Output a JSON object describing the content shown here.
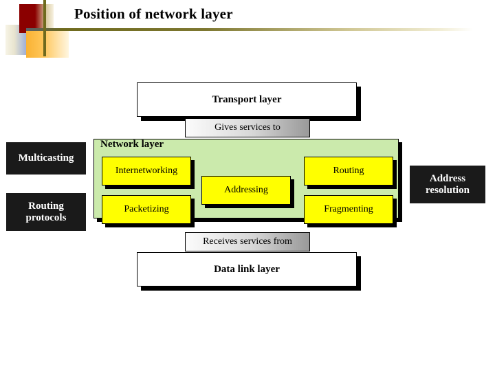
{
  "slide": {
    "title": "Position of network layer",
    "logo": {
      "red_color": "#8b0000",
      "blue_color": "#3b5bb5",
      "orange_color": "#f9b233",
      "rule_color": "#6f6a1e"
    }
  },
  "diagram": {
    "layers": {
      "transport": "Transport layer",
      "data_link": "Data link layer",
      "network": "Network layer"
    },
    "connectors": {
      "top": "Gives services to",
      "bottom": "Receives services from"
    },
    "functions": [
      {
        "label": "Internetworking"
      },
      {
        "label": "Packetizing"
      },
      {
        "label": "Addressing"
      },
      {
        "label": "Routing"
      },
      {
        "label": "Fragmenting"
      }
    ],
    "side_notes": {
      "left": [
        {
          "lines": [
            "Multicasting"
          ]
        },
        {
          "lines": [
            "Routing",
            "protocols"
          ]
        }
      ],
      "right": [
        {
          "lines": [
            "Address",
            "resolution"
          ]
        }
      ]
    },
    "colors": {
      "network_layer_fill": "#cbeaac",
      "function_fill": "#ffff00",
      "side_note_fill": "#1a1a1a",
      "layer_fill": "#ffffff",
      "shadow": "#000000"
    }
  }
}
